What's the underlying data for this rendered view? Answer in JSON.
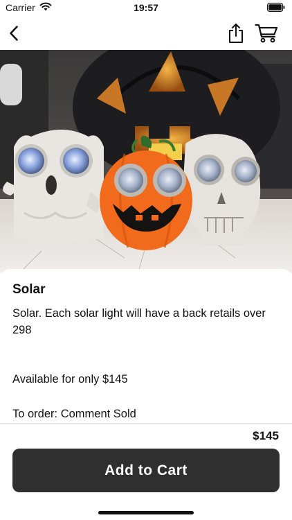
{
  "status_bar": {
    "carrier": "Carrier",
    "time": "19:57",
    "icons": [
      "wifi-icon",
      "battery-icon"
    ]
  },
  "nav": {
    "icons": [
      "chevron-left-icon",
      "share-icon",
      "cart-icon"
    ]
  },
  "product": {
    "title": "Solar",
    "description": "Solar. Each solar light will have a back retails over 298",
    "availability": "Available for only $145",
    "order_instructions": "To order: Comment Sold"
  },
  "footer": {
    "price": "$145",
    "add_to_cart_label": "Add to Cart"
  },
  "colors": {
    "button_bg": "#2f2f2f",
    "button_text": "#ffffff",
    "pumpkin_orange": "#f26a1b"
  }
}
